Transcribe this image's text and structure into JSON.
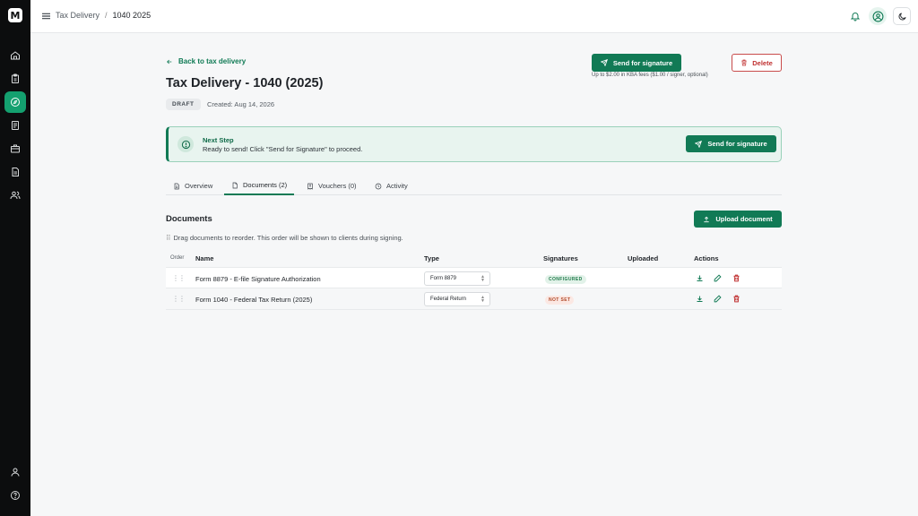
{
  "header": {
    "breadcrumb_parent": "Tax Delivery",
    "breadcrumb_sep": "/",
    "breadcrumb_current": "1040 2025"
  },
  "sidebar": {
    "logo_text": "M",
    "items": [
      "home-icon",
      "clipboard-icon",
      "compass-icon",
      "document-icon",
      "briefcase-icon",
      "file-icon",
      "users-icon"
    ],
    "active_index": 2,
    "bottom_items": [
      "user-icon",
      "help-icon"
    ]
  },
  "page": {
    "back_label": "Back to tax delivery",
    "title": "Tax Delivery - 1040 (2025)",
    "status": "DRAFT",
    "created": "Created: Aug 14, 2026",
    "send_label": "Send for signature",
    "kba_note": "Up to $2.00 in KBA fees ($1.00 / signer, optional)",
    "delete_label": "Delete"
  },
  "banner": {
    "title": "Next Step",
    "text": "Ready to send! Click \"Send for Signature\" to proceed.",
    "button": "Send for signature"
  },
  "tabs": [
    {
      "label": "Overview",
      "icon": "file-text-icon"
    },
    {
      "label": "Documents (2)",
      "icon": "file-icon"
    },
    {
      "label": "Vouchers (0)",
      "icon": "receipt-icon"
    },
    {
      "label": "Activity",
      "icon": "clock-icon"
    }
  ],
  "active_tab": 1,
  "documents": {
    "title": "Documents",
    "upload_label": "Upload document",
    "drag_hint": "Drag documents to reorder. This order will be shown to clients during signing.",
    "drag_hint_icon": "⠿",
    "columns": {
      "order": "Order",
      "name": "Name",
      "type": "Type",
      "signatures": "Signatures",
      "uploaded": "Uploaded",
      "actions": "Actions"
    },
    "rows": [
      {
        "name": "Form 8879 - E-file Signature Authorization",
        "type": "Form 8879",
        "signatures": "CONFIGURED",
        "uploaded": ""
      },
      {
        "name": "Form 1040 - Federal Tax Return (2025)",
        "type": "Federal Return",
        "signatures": "NOT SET",
        "uploaded": ""
      }
    ]
  },
  "colors": {
    "accent": "#117a55",
    "sidebar": "#0c0d0e",
    "danger": "#c03030"
  }
}
